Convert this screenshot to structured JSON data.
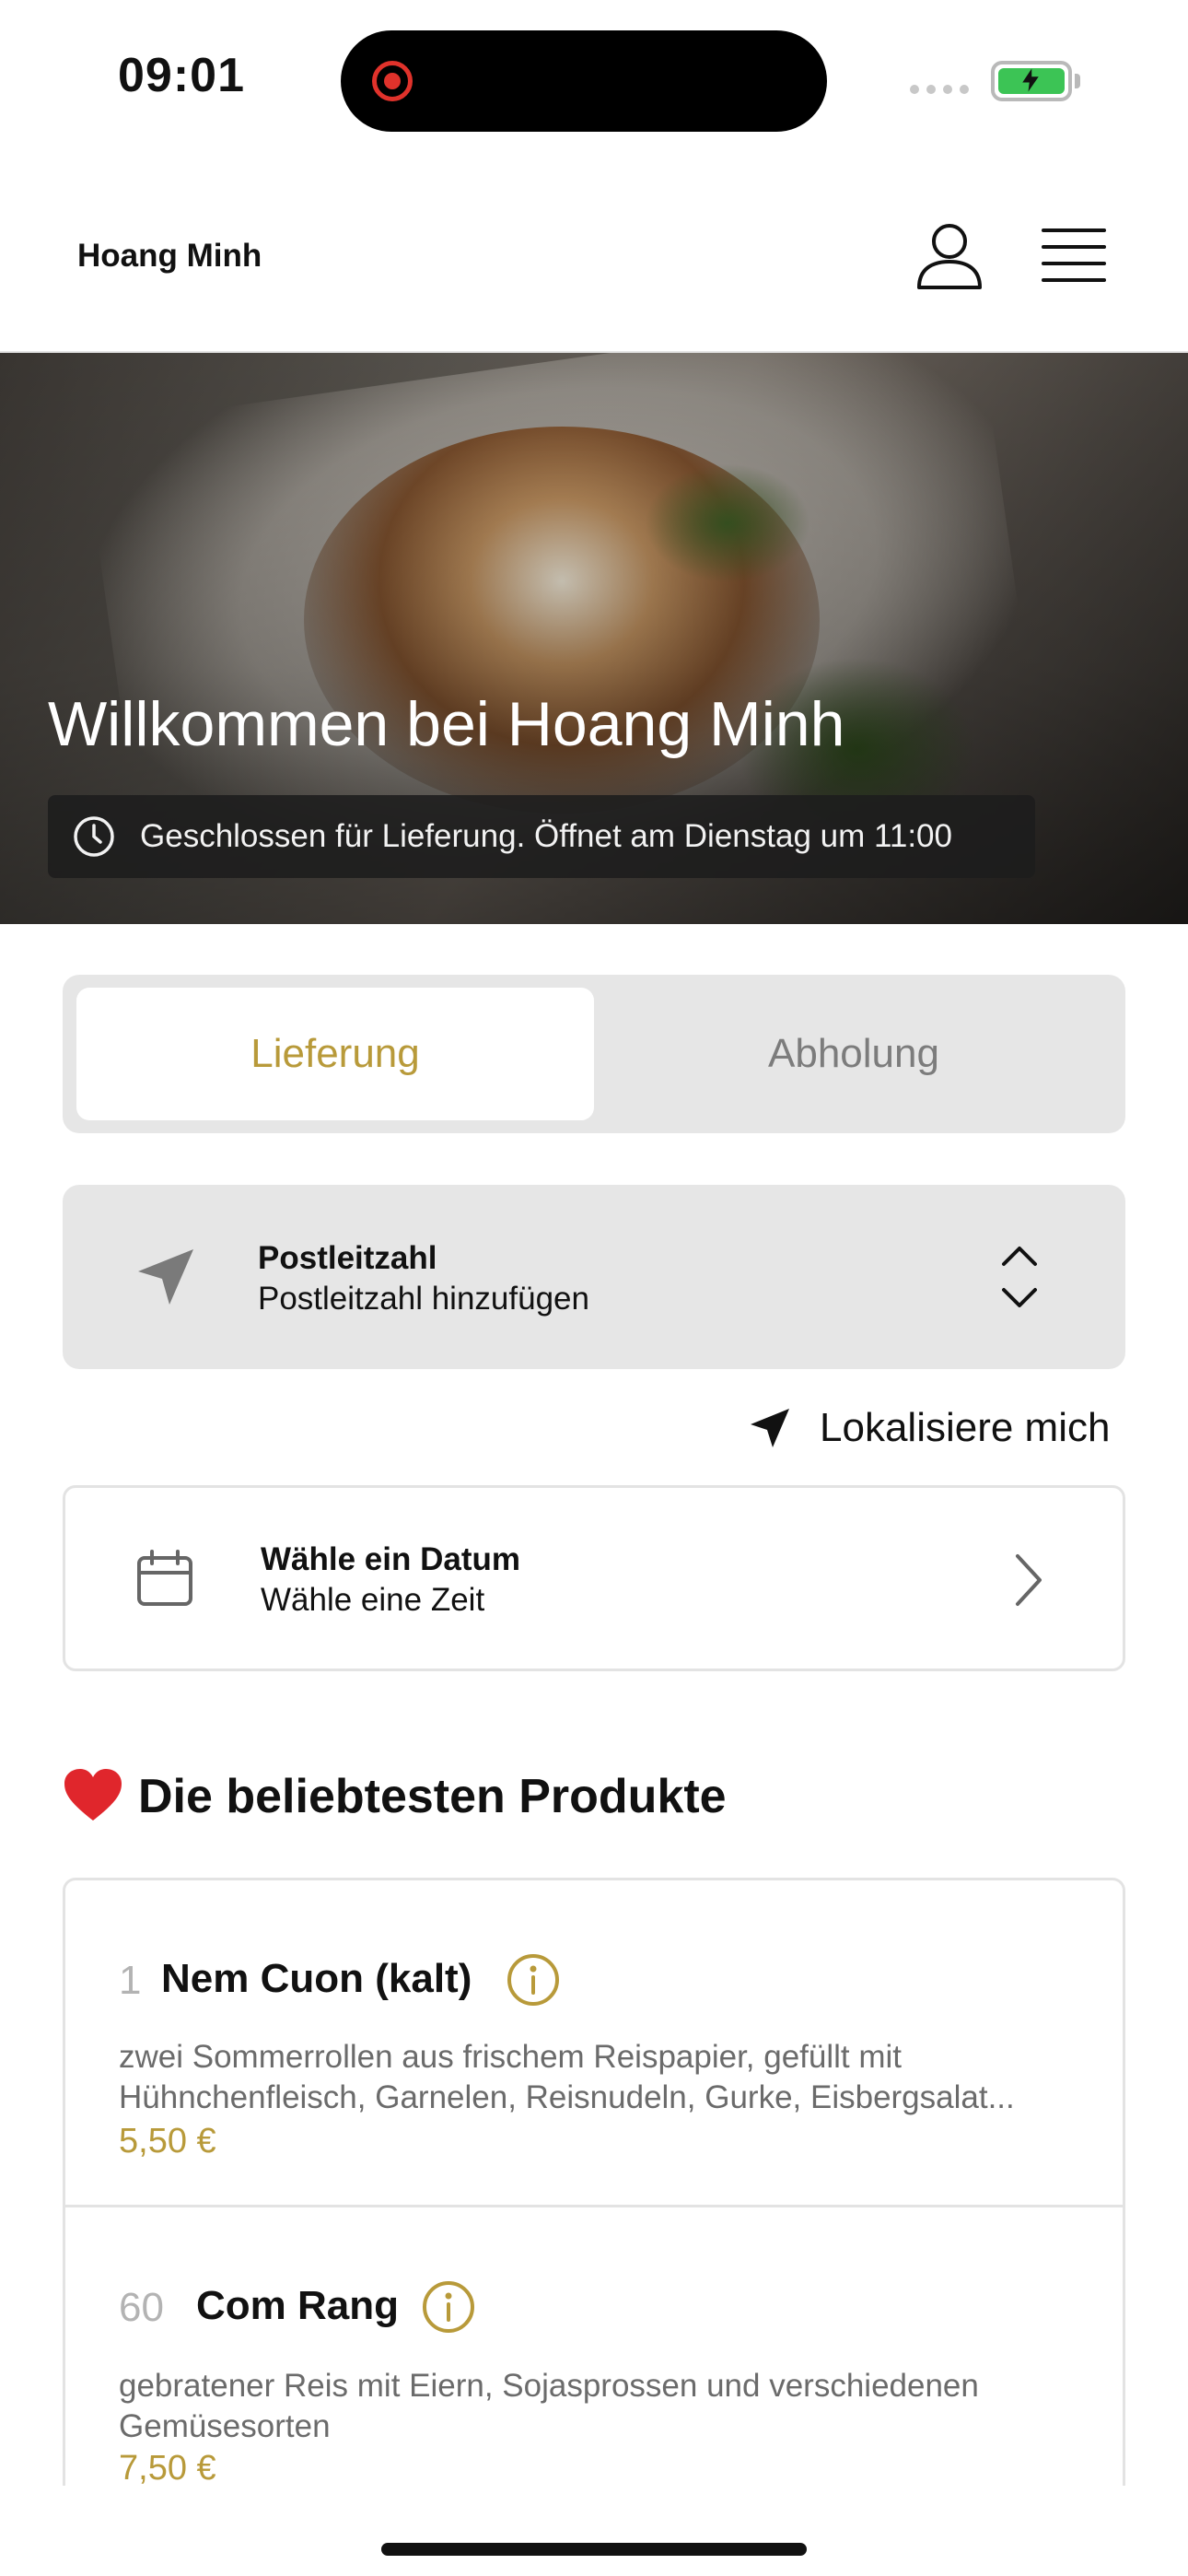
{
  "status_bar": {
    "time": "09:01"
  },
  "header": {
    "brand": "Hoang Minh"
  },
  "hero": {
    "title": "Willkommen bei Hoang Minh",
    "closed_notice": "Geschlossen für Lieferung. Öffnet am Dienstag um 11:00"
  },
  "order_mode": {
    "tabs": [
      {
        "label": "Lieferung",
        "selected": true
      },
      {
        "label": "Abholung",
        "selected": false
      }
    ]
  },
  "postcode": {
    "title": "Postleitzahl",
    "placeholder": "Postleitzahl hinzufügen"
  },
  "locate": {
    "label": "Lokalisiere mich"
  },
  "date_time": {
    "title": "Wähle ein Datum",
    "subtitle": "Wähle eine Zeit"
  },
  "popular": {
    "title": "Die beliebtesten Produkte",
    "products": [
      {
        "number": "1",
        "name": "Nem Cuon (kalt)",
        "description": "zwei Sommerrollen aus frischem Reispapier, gefüllt mit Hühnchenfleisch, Garnelen, Reisnudeln, Gurke, Eisbergsalat...",
        "price": "5,50 €"
      },
      {
        "number": "60",
        "name": "Com Rang",
        "description": "gebratener Reis mit Eiern, Sojasprossen und verschiedenen Gemüsesorten",
        "price": "7,50 €"
      }
    ]
  },
  "colors": {
    "accent": "#b89a3a",
    "battery": "#3cc455",
    "record": "#e0322b"
  }
}
